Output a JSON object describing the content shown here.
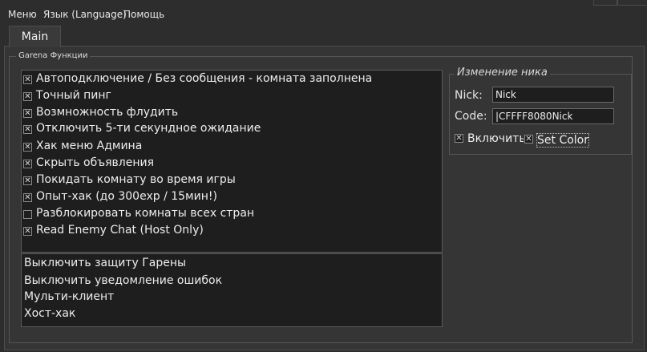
{
  "menu": {
    "items": [
      "Меню",
      "Язык (Language)",
      "Помощь"
    ]
  },
  "tabs": [
    {
      "label": "Main"
    }
  ],
  "group": {
    "title": "Garena Функции"
  },
  "options": [
    {
      "label": "Автоподключение / Без сообщения - комната заполнена",
      "checked": true
    },
    {
      "label": "Точный пинг",
      "checked": true
    },
    {
      "label": "Возмножность флудить",
      "checked": true
    },
    {
      "label": "Отключить 5-ти секундное ожидание",
      "checked": true
    },
    {
      "label": "Хак меню Админа",
      "checked": true
    },
    {
      "label": "Скрыть объявления",
      "checked": true
    },
    {
      "label": "Покидать комнату во время игры",
      "checked": true
    },
    {
      "label": "Опыт-хак (до 300exp / 15мин!)",
      "checked": true
    },
    {
      "label": "Разблокировать комнаты всех стран",
      "checked": false
    },
    {
      "label": "Read Enemy Chat (Host Only)",
      "checked": true
    }
  ],
  "extra_list": [
    "Выключить защиту Гарены",
    "Выключить уведомление ошибок",
    "Мульти-клиент",
    "Хост-хак"
  ],
  "nick_change": {
    "title": "Изменение ника",
    "nick_label": "Nick:",
    "nick_value": "Nick",
    "code_label": "Code:",
    "code_value": "|CFFFF8080Nick",
    "enable_label": "Включить",
    "enable_checked": true,
    "setcolor_label": "Set Color",
    "setcolor_checked": true
  },
  "check_mark": "✕"
}
